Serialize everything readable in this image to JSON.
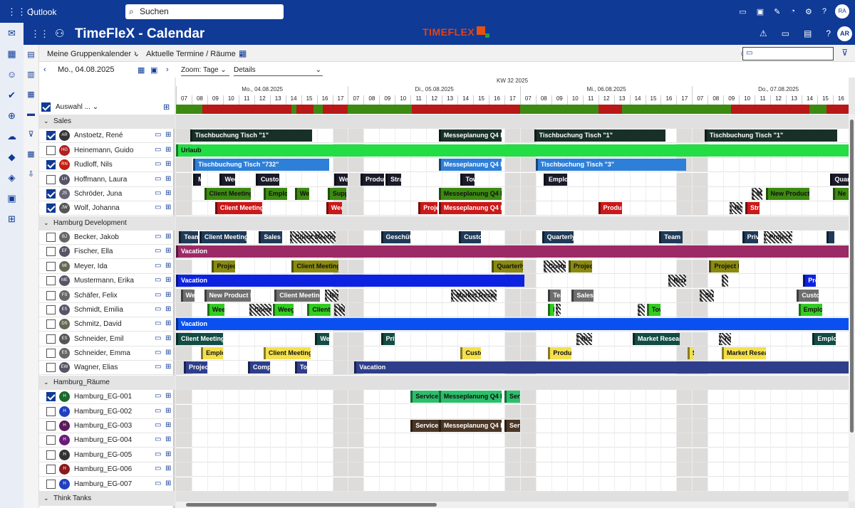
{
  "outlook": {
    "app_name": "Outlook",
    "search_placeholder": "Suchen",
    "avatar": "RA"
  },
  "app": {
    "title": "TimeFleX - Calendar",
    "brand": "TIMEFLEX",
    "avatar": "AR"
  },
  "toolbar": {
    "group_calendar": "Meine Gruppenkalender",
    "current": "Aktuelle Termine / Räume",
    "search_value": ""
  },
  "datebar": {
    "date": "Mo., 04.08.2025",
    "zoom": "Zoom: Tage",
    "details": "Details"
  },
  "selector": {
    "label": "Auswahl ..."
  },
  "header": {
    "week": "KW 32 2025",
    "days": [
      "Mo., 04.08.2025",
      "Di., 05.08.2025",
      "Mi., 06.08.2025",
      "Do., 07.08.2025"
    ],
    "hours": [
      "07",
      "08",
      "09",
      "10",
      "11",
      "12",
      "13",
      "14",
      "15",
      "16",
      "17"
    ]
  },
  "rows": [
    {
      "type": "group",
      "name": "Sales"
    },
    {
      "type": "person",
      "name": "Anstoetz, René",
      "initials": "AR",
      "checked": true,
      "color": "#333"
    },
    {
      "type": "person",
      "name": "Heinemann, Guido",
      "initials": "HG",
      "checked": false,
      "color": "#b02020"
    },
    {
      "type": "person",
      "name": "Rudloff, Nils",
      "initials": "RN",
      "checked": true,
      "color": "#c02010"
    },
    {
      "type": "person",
      "name": "Hoffmann, Laura",
      "initials": "LH",
      "checked": false,
      "color": "#556"
    },
    {
      "type": "person",
      "name": "Schröder, Juna",
      "initials": "JS",
      "checked": true,
      "color": "#667"
    },
    {
      "type": "person",
      "name": "Wolf, Johanna",
      "initials": "JW",
      "checked": true,
      "color": "#555"
    },
    {
      "type": "group",
      "name": "Hamburg Development"
    },
    {
      "type": "person",
      "name": "Becker, Jakob",
      "initials": "BJ",
      "checked": false,
      "color": "#666"
    },
    {
      "type": "person",
      "name": "Fischer, Ella",
      "initials": "EF",
      "checked": false,
      "color": "#556"
    },
    {
      "type": "person",
      "name": "Meyer, Ida",
      "initials": "MI",
      "checked": false,
      "color": "#665"
    },
    {
      "type": "person",
      "name": "Mustermann, Erika",
      "initials": "ME",
      "checked": false,
      "color": "#556"
    },
    {
      "type": "person",
      "name": "Schäfer, Felix",
      "initials": "FS",
      "checked": false,
      "color": "#666"
    },
    {
      "type": "person",
      "name": "Schmidt, Emilia",
      "initials": "ES",
      "checked": false,
      "color": "#556"
    },
    {
      "type": "person",
      "name": "Schmitz, David",
      "initials": "DS",
      "checked": false,
      "color": "#665"
    },
    {
      "type": "person",
      "name": "Schneider, Emil",
      "initials": "ES",
      "checked": false,
      "color": "#555"
    },
    {
      "type": "person",
      "name": "Schneider, Emma",
      "initials": "ES",
      "checked": false,
      "color": "#666"
    },
    {
      "type": "person",
      "name": "Wagner, Elias",
      "initials": "EW",
      "checked": false,
      "color": "#556"
    },
    {
      "type": "group",
      "name": "Hamburg_Räume"
    },
    {
      "type": "person",
      "name": "Hamburg_EG-001",
      "initials": "H",
      "checked": true,
      "color": "#1a6a2a"
    },
    {
      "type": "person",
      "name": "Hamburg_EG-002",
      "initials": "H",
      "checked": false,
      "color": "#2040c0"
    },
    {
      "type": "person",
      "name": "Hamburg_EG-003",
      "initials": "H",
      "checked": false,
      "color": "#5a1a5a"
    },
    {
      "type": "person",
      "name": "Hamburg_EG-004",
      "initials": "H",
      "checked": false,
      "color": "#6a1a7a"
    },
    {
      "type": "person",
      "name": "Hamburg_EG-005",
      "initials": "H",
      "checked": false,
      "color": "#333"
    },
    {
      "type": "person",
      "name": "Hamburg_EG-006",
      "initials": "H",
      "checked": false,
      "color": "#8a1a1a"
    },
    {
      "type": "person",
      "name": "Hamburg_EG-007",
      "initials": "H",
      "checked": false,
      "color": "#2040c0"
    },
    {
      "type": "group",
      "name": "Think Tanks"
    }
  ],
  "events": [
    [],
    [
      {
        "s": 0.9,
        "e": 8.7,
        "t": "Tischbuchung Tisch \"1\"",
        "c": "#183028"
      },
      {
        "s": 16.8,
        "e": 20.8,
        "t": "Messeplanung Q4 K",
        "c": "#183028"
      },
      {
        "s": 22.9,
        "e": 31.3,
        "t": "Tischbuchung Tisch \"1\"",
        "c": "#183028"
      },
      {
        "s": 33.8,
        "e": 42.3,
        "t": "Tischbuchung Tisch \"1\"",
        "c": "#183028"
      }
    ],
    [
      {
        "s": 0,
        "e": 43,
        "t": "Urlaub",
        "c": "#22dd44",
        "dk": true
      }
    ],
    [
      {
        "s": 1.1,
        "e": 9.8,
        "t": "Tischbuchung Tisch \"732\"",
        "c": "#2e7fd8"
      },
      {
        "s": 16.8,
        "e": 20.8,
        "t": "Messeplanung Q4 K",
        "c": "#2e7fd8"
      },
      {
        "s": 23,
        "e": 32.6,
        "t": "Tischbuchung Tisch \"3\"",
        "c": "#2e7fd8"
      }
    ],
    [
      {
        "s": 1.1,
        "e": 1.6,
        "t": "M",
        "c": "#1a1a2a"
      },
      {
        "s": 2.8,
        "e": 3.8,
        "t": "Wee",
        "c": "#1a1a2a"
      },
      {
        "s": 5.1,
        "e": 6.6,
        "t": "Custor",
        "c": "#1a1a2a"
      },
      {
        "s": 10.1,
        "e": 11,
        "t": "Wee",
        "c": "#1a1a2a"
      },
      {
        "s": 11.8,
        "e": 13.3,
        "t": "Produ",
        "c": "#1a1a2a"
      },
      {
        "s": 13.4,
        "e": 14.4,
        "t": "Stra",
        "c": "#1a1a2a"
      },
      {
        "s": 18.2,
        "e": 19.1,
        "t": "Tow",
        "c": "#1a1a2a"
      },
      {
        "s": 23.5,
        "e": 25,
        "t": "Emplo",
        "c": "#1a1a2a"
      },
      {
        "s": 41.8,
        "e": 43,
        "t": "Quar",
        "c": "#1a1a2a"
      }
    ],
    [
      {
        "s": 1.8,
        "e": 4.8,
        "t": "Client Meeting",
        "c": "#3d8a12",
        "dk": true
      },
      {
        "s": 5.6,
        "e": 7.1,
        "t": "Emplo",
        "c": "#3d8a12",
        "dk": true
      },
      {
        "s": 7.6,
        "e": 8.5,
        "t": "Wee",
        "c": "#3d8a12",
        "dk": true
      },
      {
        "s": 9.7,
        "e": 10.9,
        "t": "Supp",
        "c": "#3d8a12",
        "dk": true
      },
      {
        "s": 16.8,
        "e": 20.8,
        "t": "Messeplanung Q4 K",
        "c": "#3d8a12",
        "dk": true
      },
      {
        "s": 36.8,
        "e": 37.5,
        "t": "Ma",
        "c": "#3d8a12",
        "dk": true,
        "hat": true
      },
      {
        "s": 37.7,
        "e": 40.5,
        "t": "New Product L",
        "c": "#3d8a12",
        "dk": true
      },
      {
        "s": 42,
        "e": 43,
        "t": "Ne",
        "c": "#3d8a12",
        "dk": true
      }
    ],
    [
      {
        "s": 2.5,
        "e": 5.5,
        "t": "Client Meeting",
        "c": "#cc1818"
      },
      {
        "s": 9.6,
        "e": 10.6,
        "t": "Wee",
        "c": "#cc1818"
      },
      {
        "s": 15.5,
        "e": 16.7,
        "t": "Proje",
        "c": "#cc1818"
      },
      {
        "s": 16.8,
        "e": 20.8,
        "t": "Messeplanung Q4 K",
        "c": "#cc1818"
      },
      {
        "s": 27,
        "e": 28.5,
        "t": "Produ",
        "c": "#cc1818"
      },
      {
        "s": 35.4,
        "e": 36.2,
        "t": "Risk",
        "c": "#cc1818",
        "hat": true
      },
      {
        "s": 36.4,
        "e": 37.3,
        "t": "Stra",
        "c": "#cc1818"
      }
    ],
    [],
    [
      {
        "s": 0.2,
        "e": 1.4,
        "t": "Team",
        "c": "#1e3a58"
      },
      {
        "s": 1.5,
        "e": 4.5,
        "t": "Client Meeting",
        "c": "#1e3a58"
      },
      {
        "s": 5.3,
        "e": 6.8,
        "t": "Sales T",
        "c": "#1e3a58"
      },
      {
        "s": 7.3,
        "e": 10.2,
        "t": "Client Meeting",
        "c": "#1e3a58",
        "hat": true
      },
      {
        "s": 13.1,
        "e": 15,
        "t": "Geschütz",
        "c": "#1e3a58"
      },
      {
        "s": 18.1,
        "e": 19.5,
        "t": "Custor",
        "c": "#1e3a58"
      },
      {
        "s": 23.4,
        "e": 25.4,
        "t": "Quarterly",
        "c": "#1e3a58"
      },
      {
        "s": 30.9,
        "e": 32.4,
        "t": "Team E",
        "c": "#1e3a58"
      },
      {
        "s": 36.2,
        "e": 37.2,
        "t": "Priv",
        "c": "#1e3a58"
      },
      {
        "s": 37.6,
        "e": 39.4,
        "t": "Project K",
        "c": "#1e3a58",
        "hat": true
      },
      {
        "s": 41.6,
        "e": 42.1,
        "t": "",
        "c": "#1e3a58"
      }
    ],
    [
      {
        "s": 0,
        "e": 43,
        "t": "Vacation",
        "c": "#9c2a66"
      }
    ],
    [
      {
        "s": 2.3,
        "e": 3.8,
        "t": "Projec",
        "c": "#8a8a10",
        "dk": true
      },
      {
        "s": 7.4,
        "e": 10.4,
        "t": "Client Meeting",
        "c": "#8a8a10",
        "dk": true
      },
      {
        "s": 20.2,
        "e": 22.2,
        "t": "Quarterly",
        "c": "#8a8a10",
        "dk": true
      },
      {
        "s": 23.5,
        "e": 24.9,
        "t": "Custor",
        "c": "#8a8a10",
        "dk": true,
        "hat": true
      },
      {
        "s": 25.1,
        "e": 26.6,
        "t": "Projec",
        "c": "#8a8a10",
        "dk": true
      },
      {
        "s": 34.1,
        "e": 36,
        "t": "Project K",
        "c": "#8a8a10",
        "dk": true
      }
    ],
    [
      {
        "s": 0,
        "e": 22.3,
        "t": "Vacation",
        "c": "#0d22e0"
      },
      {
        "s": 31.5,
        "e": 32.6,
        "t": "Risk",
        "c": "#0d22e0",
        "hat": true
      },
      {
        "s": 34.9,
        "e": 35.3,
        "t": "",
        "c": "#0d22e0",
        "hat": true
      },
      {
        "s": 40.1,
        "e": 40.9,
        "t": "Pro",
        "c": "#0d22e0"
      }
    ],
    [
      {
        "s": 0.3,
        "e": 1.2,
        "t": "Wee",
        "c": "#6e6e6e"
      },
      {
        "s": 1.8,
        "e": 4.8,
        "t": "New Product L",
        "c": "#6e6e6e"
      },
      {
        "s": 6.3,
        "e": 9.2,
        "t": "Client Meeting",
        "c": "#6e6e6e"
      },
      {
        "s": 9.5,
        "e": 10.4,
        "t": "Risk",
        "c": "#6e6e6e",
        "hat": true
      },
      {
        "s": 17.6,
        "e": 20.5,
        "t": "Market Resear",
        "c": "#6e6e6e",
        "hat": true
      },
      {
        "s": 23.8,
        "e": 24.6,
        "t": "Tear",
        "c": "#6e6e6e"
      },
      {
        "s": 25.3,
        "e": 26.7,
        "t": "Sales T",
        "c": "#6e6e6e"
      },
      {
        "s": 33.5,
        "e": 34.4,
        "t": "Stra",
        "c": "#6e6e6e",
        "hat": true
      },
      {
        "s": 39.7,
        "e": 41.1,
        "t": "Custor",
        "c": "#6e6e6e"
      }
    ],
    [
      {
        "s": 2,
        "e": 3.1,
        "t": "Wee",
        "c": "#33cc22",
        "dk": true
      },
      {
        "s": 4.7,
        "e": 6.1,
        "t": "Client M",
        "c": "#33cc22",
        "dk": true,
        "hat": true
      },
      {
        "s": 6.2,
        "e": 7.5,
        "t": "Weeg",
        "c": "#33cc22",
        "dk": true
      },
      {
        "s": 8.4,
        "e": 9.9,
        "t": "Client",
        "c": "#33cc22",
        "dk": true
      },
      {
        "s": 10.1,
        "e": 10.8,
        "t": "Wi",
        "c": "#33cc22",
        "dk": true,
        "hat": true
      },
      {
        "s": 23.8,
        "e": 24.2,
        "t": "Mi",
        "c": "#33cc22",
        "dk": true
      },
      {
        "s": 24.3,
        "e": 24.6,
        "t": "",
        "c": "#33cc22",
        "dk": true,
        "hat": true
      },
      {
        "s": 29.5,
        "e": 30,
        "t": "",
        "c": "#33cc22",
        "dk": true,
        "hat": true
      },
      {
        "s": 30.1,
        "e": 31,
        "t": "Tow",
        "c": "#33cc22",
        "dk": true
      },
      {
        "s": 39.8,
        "e": 41.3,
        "t": "Emplo",
        "c": "#33cc22",
        "dk": true
      }
    ],
    [
      {
        "s": 0,
        "e": 43,
        "t": "Vacation",
        "c": "#0a50f0"
      }
    ],
    [
      {
        "s": 0,
        "e": 3,
        "t": "Client Meeting",
        "c": "#124c44"
      },
      {
        "s": 8.9,
        "e": 9.8,
        "t": "Wee",
        "c": "#124c44"
      },
      {
        "s": 13.1,
        "e": 14,
        "t": "Priv",
        "c": "#124c44"
      },
      {
        "s": 25.6,
        "e": 26.6,
        "t": "Risk",
        "c": "#124c44",
        "hat": true
      },
      {
        "s": 29.2,
        "e": 32.2,
        "t": "Market Resear",
        "c": "#124c44"
      },
      {
        "s": 34.7,
        "e": 35.5,
        "t": "Tow",
        "c": "#124c44",
        "hat": true
      },
      {
        "s": 40.7,
        "e": 42.2,
        "t": "Emplo",
        "c": "#124c44"
      }
    ],
    [
      {
        "s": 1.6,
        "e": 3,
        "t": "Emplo",
        "c": "#f4e04e",
        "dk": true
      },
      {
        "s": 5.6,
        "e": 8.6,
        "t": "Client Meeting",
        "c": "#f4e04e",
        "dk": true
      },
      {
        "s": 18.2,
        "e": 19.5,
        "t": "Custor",
        "c": "#f4e04e",
        "dk": true
      },
      {
        "s": 23.8,
        "e": 25.3,
        "t": "Produ",
        "c": "#f4e04e",
        "dk": true
      },
      {
        "s": 32.7,
        "e": 33.1,
        "t": "S",
        "c": "#f4e04e",
        "dk": true
      },
      {
        "s": 34.9,
        "e": 37.7,
        "t": "Market Resear",
        "c": "#f4e04e",
        "dk": true
      }
    ],
    [
      {
        "s": 0.5,
        "e": 2,
        "t": "Projec",
        "c": "#2f3e8a"
      },
      {
        "s": 4.6,
        "e": 6,
        "t": "Compa",
        "c": "#2f3e8a"
      },
      {
        "s": 7.6,
        "e": 8.4,
        "t": "Tow",
        "c": "#2f3e8a"
      },
      {
        "s": 11.4,
        "e": 43,
        "t": "Vacation",
        "c": "#2f3e8a"
      }
    ],
    [],
    [
      {
        "s": 15,
        "e": 16.8,
        "t": "Service R",
        "c": "#2bbf6a",
        "dk": true
      },
      {
        "s": 16.8,
        "e": 20.8,
        "t": "Messeplanung Q4 K",
        "c": "#2bbf6a",
        "dk": true
      },
      {
        "s": 21,
        "e": 22,
        "t": "Serv",
        "c": "#2bbf6a",
        "dk": true
      }
    ],
    [],
    [
      {
        "s": 15,
        "e": 16.8,
        "t": "Service R",
        "c": "#4a3626"
      },
      {
        "s": 16.8,
        "e": 20.8,
        "t": "Messeplanung Q4 K",
        "c": "#4a3626"
      },
      {
        "s": 21,
        "e": 22,
        "t": "Serv",
        "c": "#4a3626"
      }
    ],
    [],
    [],
    [],
    [],
    []
  ],
  "status_bar": [
    {
      "s": 0,
      "e": 1.7,
      "c": "#3d8a12"
    },
    {
      "s": 1.7,
      "e": 7.4,
      "c": "#b81818"
    },
    {
      "s": 7.4,
      "e": 7.7,
      "c": "#3d8a12"
    },
    {
      "s": 7.7,
      "e": 8.8,
      "c": "#b81818"
    },
    {
      "s": 8.8,
      "e": 9.4,
      "c": "#3d8a12"
    },
    {
      "s": 9.4,
      "e": 11,
      "c": "#b81818"
    },
    {
      "s": 11,
      "e": 15.1,
      "c": "#3d8a12"
    },
    {
      "s": 15.1,
      "e": 22,
      "c": "#b81818"
    },
    {
      "s": 22,
      "e": 27,
      "c": "#3d8a12"
    },
    {
      "s": 27,
      "e": 28.5,
      "c": "#b81818"
    },
    {
      "s": 28.5,
      "e": 33,
      "c": "#3d8a12"
    },
    {
      "s": 33,
      "e": 35.5,
      "c": "#3d8a12"
    },
    {
      "s": 35.5,
      "e": 40.5,
      "c": "#b81818"
    },
    {
      "s": 40.5,
      "e": 41.6,
      "c": "#3d8a12"
    },
    {
      "s": 41.6,
      "e": 43,
      "c": "#b81818"
    }
  ]
}
